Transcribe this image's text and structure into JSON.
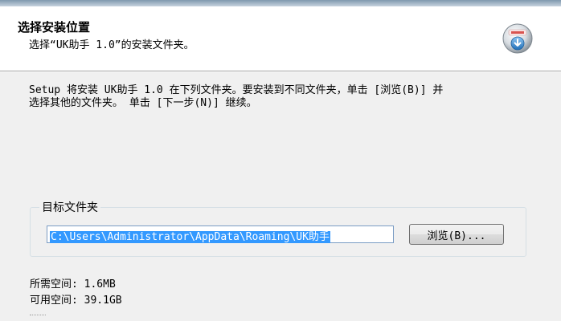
{
  "header": {
    "title": "选择安装位置",
    "subtitle": "选择“UK助手 1.0”的安装文件夹。",
    "icon": "installer-disk-icon"
  },
  "description": {
    "line1": "Setup 将安装 UK助手 1.0 在下列文件夹。要安装到不同文件夹，单击 [浏览(B)] 并",
    "line2": "选择其他的文件夹。 单击 [下一步(N)] 继续。"
  },
  "destination": {
    "group_label": "目标文件夹",
    "path": "C:\\Users\\Administrator\\AppData\\Roaming\\UK助手",
    "browse_label": "浏览(B)..."
  },
  "space": {
    "required": "所需空间: 1.6MB",
    "available": "可用空间: 39.1GB"
  }
}
